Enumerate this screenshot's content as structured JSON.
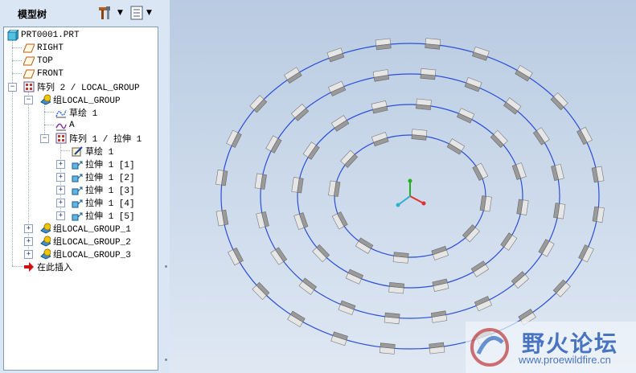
{
  "model_tree": {
    "title": "模型树",
    "toolbar": {
      "settings_icon": "tools-icon",
      "show_icon": "list-view-icon"
    },
    "items": [
      {
        "label": "PRT0001.PRT",
        "icon": "part-icon"
      },
      {
        "label": "RIGHT",
        "icon": "datum-plane-icon"
      },
      {
        "label": "TOP",
        "icon": "datum-plane-icon"
      },
      {
        "label": "FRONT",
        "icon": "datum-plane-icon"
      },
      {
        "label": "阵列 2 / LOCAL_GROUP",
        "icon": "pattern-icon"
      },
      {
        "label": "组LOCAL_GROUP",
        "icon": "group-icon"
      },
      {
        "label": "草绘 1",
        "icon": "sketch-icon"
      },
      {
        "label": "A",
        "icon": "curve-icon"
      },
      {
        "label": "阵列 1 / 拉伸 1",
        "icon": "pattern-icon"
      },
      {
        "label": "草绘 1",
        "icon": "sketch-edit-icon"
      },
      {
        "label": "拉伸 1 [1]",
        "icon": "extrude-icon"
      },
      {
        "label": "拉伸 1 [2]",
        "icon": "extrude-icon"
      },
      {
        "label": "拉伸 1 [3]",
        "icon": "extrude-icon"
      },
      {
        "label": "拉伸 1 [4]",
        "icon": "extrude-icon"
      },
      {
        "label": "拉伸 1 [5]",
        "icon": "extrude-icon"
      },
      {
        "label": "组LOCAL_GROUP_1",
        "icon": "group-icon"
      },
      {
        "label": "组LOCAL_GROUP_2",
        "icon": "group-icon"
      },
      {
        "label": "组LOCAL_GROUP_3",
        "icon": "group-icon"
      },
      {
        "label": "在此插入",
        "icon": "insert-here-arrow-icon"
      }
    ]
  },
  "watermark": {
    "brand": "野火论坛",
    "url": "www.proewildfire.cn"
  },
  "colors": {
    "ring": "#2b4fd6",
    "background_top": "#b9cbe2",
    "background_bottom": "#dfe8f3",
    "block": "#e6e6e6",
    "axis_x": "#e03030",
    "axis_y": "#20b020",
    "axis_z": "#30b0d0"
  }
}
